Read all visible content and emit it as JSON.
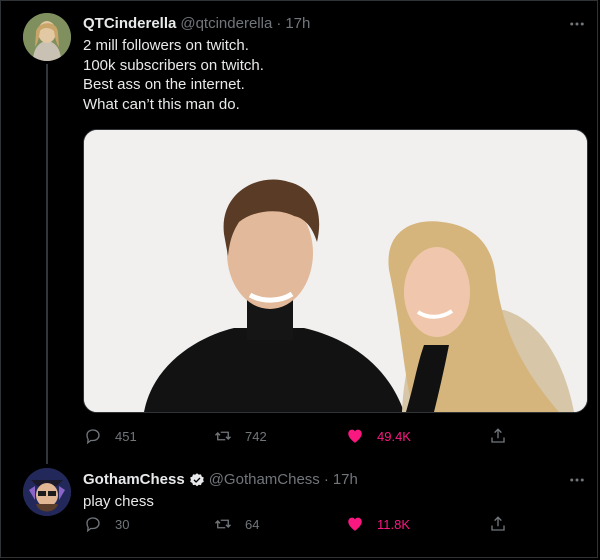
{
  "tweets": [
    {
      "author": {
        "name": "QTCinderella",
        "handle": "@qtcinderella",
        "verified": false
      },
      "time": "17h",
      "text_lines": [
        "2 mill followers on twitch.",
        "100k subscribers on twitch.",
        "Best ass on the internet.",
        "What can’t this man do."
      ],
      "has_media": true,
      "metrics": {
        "replies": "451",
        "retweets": "742",
        "likes": "49.4K",
        "liked": true
      }
    },
    {
      "author": {
        "name": "GothamChess",
        "handle": "@GothamChess",
        "verified": true
      },
      "time": "17h",
      "text_lines": [
        "play chess"
      ],
      "has_media": false,
      "metrics": {
        "replies": "30",
        "retweets": "64",
        "likes": "11.8K",
        "liked": true
      }
    }
  ],
  "separator": "·",
  "colors": {
    "background": "#000000",
    "text_primary": "#e7e9ea",
    "text_secondary": "#71767b",
    "like_active": "#f91880",
    "verified_badge": "#e7e9ea",
    "thread_line": "#333639"
  },
  "icons": {
    "more": "more-horizontal-icon",
    "reply": "reply-icon",
    "retweet": "retweet-icon",
    "like": "heart-icon",
    "share": "share-icon",
    "verified": "verified-badge-icon"
  }
}
